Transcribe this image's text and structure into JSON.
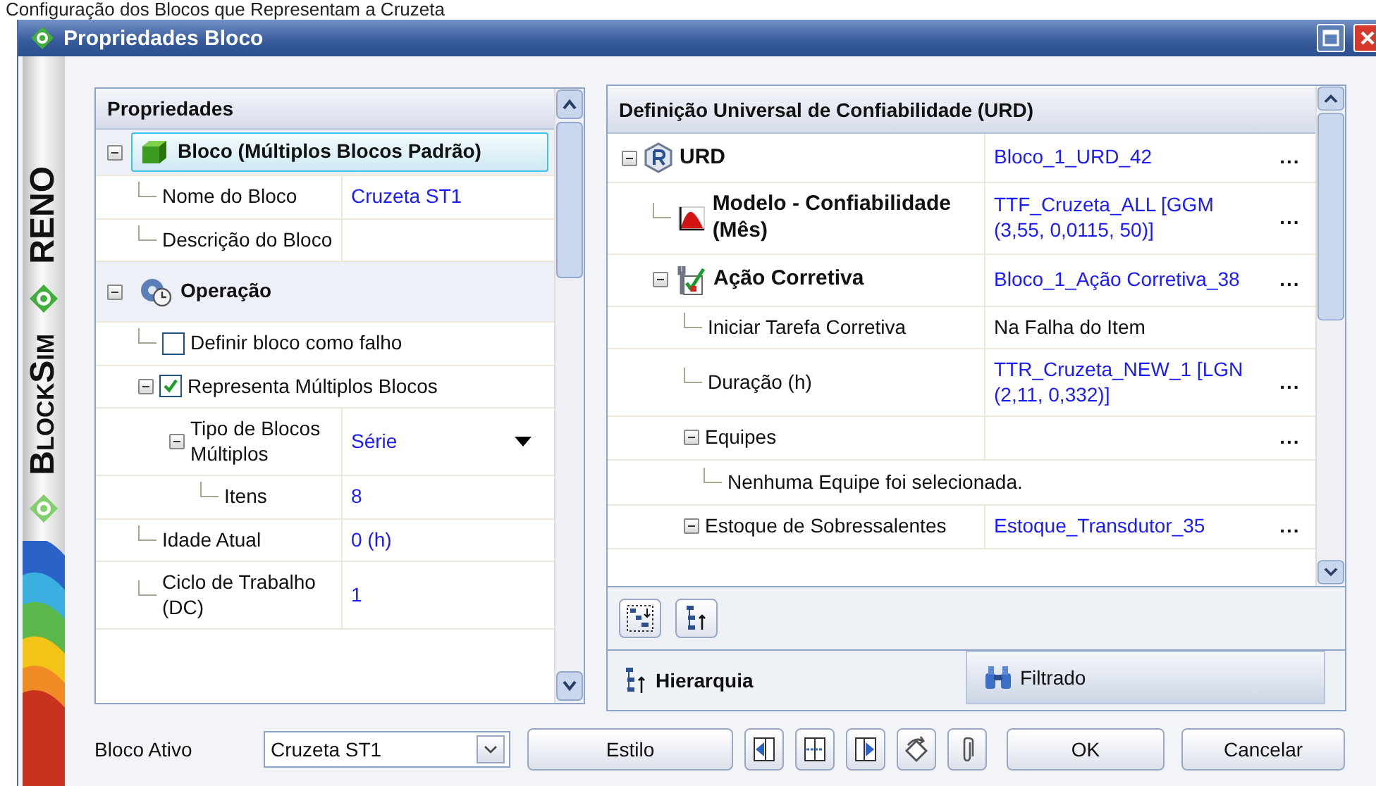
{
  "caption": "Configuração dos Blocos que Representam a Cruzeta",
  "window": {
    "title": "Propriedades Bloco"
  },
  "brand": {
    "company": "RENO",
    "product": "BlockSim"
  },
  "properties": {
    "title": "Propriedades",
    "items": [
      {
        "kind": "group",
        "label": "Bloco (Múltiplos Blocos Padrão)",
        "expanded": true,
        "selected": true,
        "children": [
          {
            "kind": "property",
            "label": "Nome do Bloco",
            "value": "Cruzeta ST1"
          },
          {
            "kind": "property",
            "label": "Descrição do Bloco"
          }
        ]
      },
      {
        "kind": "group",
        "label": "Operação",
        "expanded": true,
        "selected": false,
        "children": [
          {
            "kind": "checkbox",
            "label": "Definir bloco como falho",
            "checked": false
          },
          {
            "kind": "checkbox",
            "label": "Representa Múltiplos Blocos",
            "checked": true,
            "expanded": true,
            "children": [
              {
                "kind": "dropdown",
                "label": "Tipo de Blocos Múltiplos",
                "value": "Série",
                "expanded": true,
                "children": [
                  {
                    "kind": "property",
                    "label": "Itens",
                    "value": "8"
                  }
                ]
              }
            ]
          },
          {
            "kind": "property",
            "label": "Idade Atual",
            "value": "0 (h)"
          },
          {
            "kind": "property",
            "label": "Ciclo de Trabalho (DC)",
            "value": "1"
          }
        ]
      }
    ]
  },
  "urd": {
    "title": "Definição Universal de Confiabilidade (URD)",
    "rows": [
      {
        "kind": "section",
        "label": "URD",
        "value": "Bloco_1_URD_42",
        "linked": true,
        "action": "...",
        "expanded": true,
        "children": [
          {
            "kind": "section",
            "label": "Modelo - Confiabilidade (Mês)",
            "value": "TTF_Cruzeta_ALL [GGM (3,55, 0,0115, 50)]",
            "linked": true,
            "action": "..."
          },
          {
            "kind": "section",
            "label": "Ação Corretiva",
            "value": "Bloco_1_Ação Corretiva_38",
            "linked": true,
            "action": "...",
            "expanded": true,
            "children": [
              {
                "kind": "property",
                "label": "Iniciar Tarefa Corretiva",
                "value": "Na Falha do Item",
                "linked": false
              },
              {
                "kind": "property",
                "label": "Duração (h)",
                "value": "TTR_Cruzeta_NEW_1 [LGN (2,11, 0,332)]",
                "linked": true,
                "action": "..."
              },
              {
                "kind": "property",
                "label": "Equipes",
                "action": "...",
                "expanded": true,
                "children": [
                  {
                    "kind": "note",
                    "label": "Nenhuma Equipe foi selecionada."
                  }
                ]
              },
              {
                "kind": "property",
                "label": "Estoque de Sobressalentes",
                "value": "Estoque_Transdutor_35",
                "linked": true,
                "action": "...",
                "expanded": true
              }
            ]
          }
        ]
      }
    ],
    "tabs": [
      {
        "label": "Hierarquia",
        "selected": true
      },
      {
        "label": "Filtrado",
        "selected": false
      }
    ]
  },
  "footer": {
    "label": "Bloco Ativo",
    "active_block": "Cruzeta ST1",
    "style_button": "Estilo",
    "ok": "OK",
    "cancel": "Cancelar"
  }
}
